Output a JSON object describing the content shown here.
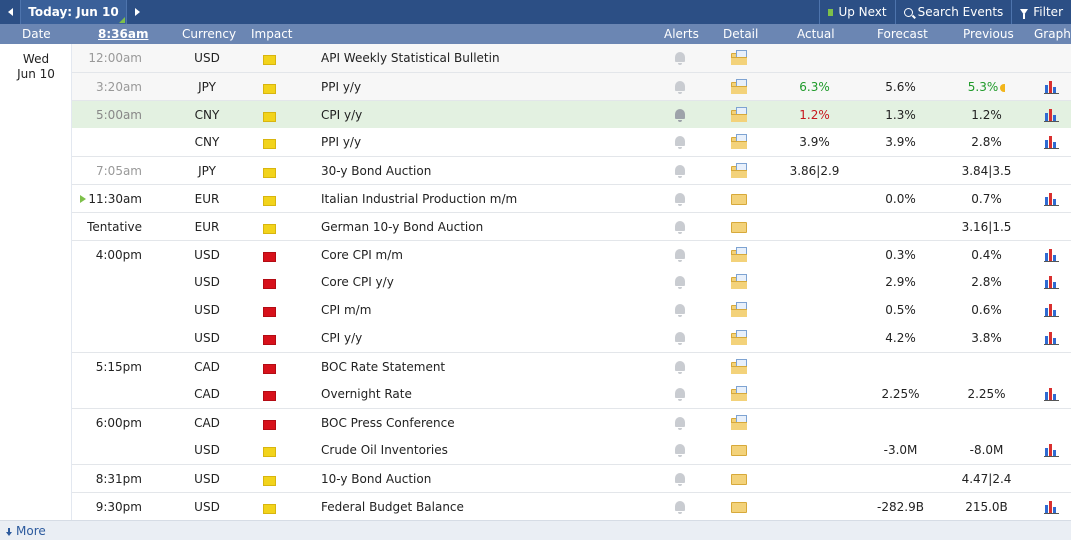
{
  "toolbar": {
    "today_label": "Today: Jun 10",
    "up_next_label": "Up Next",
    "search_label": "Search Events",
    "filter_label": "Filter"
  },
  "columns": {
    "date": "Date",
    "time": "8:36am",
    "currency": "Currency",
    "impact": "Impact",
    "alerts": "Alerts",
    "detail": "Detail",
    "actual": "Actual",
    "forecast": "Forecast",
    "previous": "Previous",
    "graph": "Graph"
  },
  "date": {
    "day": "Wed",
    "date": "Jun 10"
  },
  "events": [
    {
      "time": "12:00am",
      "currency": "USD",
      "impact": "low",
      "event": "API Weekly Statistical Bulletin",
      "detail": "doc",
      "actual": "",
      "forecast": "",
      "previous": "",
      "graph": false
    },
    {
      "time": "3:20am",
      "currency": "JPY",
      "impact": "low",
      "event": "PPI y/y",
      "detail": "doc",
      "actual": "6.3%",
      "forecast": "5.6%",
      "previous": "5.3%",
      "graph": true
    },
    {
      "time": "5:00am",
      "currency": "CNY",
      "impact": "low",
      "event": "CPI y/y",
      "detail": "doc",
      "actual": "1.2%",
      "forecast": "1.3%",
      "previous": "1.2%",
      "graph": true
    },
    {
      "time": "",
      "currency": "CNY",
      "impact": "low",
      "event": "PPI y/y",
      "detail": "doc",
      "actual": "3.9%",
      "forecast": "3.9%",
      "previous": "2.8%",
      "graph": true
    },
    {
      "time": "7:05am",
      "currency": "JPY",
      "impact": "low",
      "event": "30-y Bond Auction",
      "detail": "doc",
      "actual": "3.86|2.9",
      "forecast": "",
      "previous": "3.84|3.5",
      "graph": false
    },
    {
      "time": "11:30am",
      "currency": "EUR",
      "impact": "low",
      "event": "Italian Industrial Production m/m",
      "detail": "plain",
      "actual": "",
      "forecast": "0.0%",
      "previous": "0.7%",
      "graph": true
    },
    {
      "time": "Tentative",
      "currency": "EUR",
      "impact": "low",
      "event": "German 10-y Bond Auction",
      "detail": "plain",
      "actual": "",
      "forecast": "",
      "previous": "3.16|1.5",
      "graph": false
    },
    {
      "time": "4:00pm",
      "currency": "USD",
      "impact": "high",
      "event": "Core CPI m/m",
      "detail": "doc",
      "actual": "",
      "forecast": "0.3%",
      "previous": "0.4%",
      "graph": true
    },
    {
      "time": "",
      "currency": "USD",
      "impact": "high",
      "event": "Core CPI y/y",
      "detail": "doc",
      "actual": "",
      "forecast": "2.9%",
      "previous": "2.8%",
      "graph": true
    },
    {
      "time": "",
      "currency": "USD",
      "impact": "high",
      "event": "CPI m/m",
      "detail": "doc",
      "actual": "",
      "forecast": "0.5%",
      "previous": "0.6%",
      "graph": true
    },
    {
      "time": "",
      "currency": "USD",
      "impact": "high",
      "event": "CPI y/y",
      "detail": "doc",
      "actual": "",
      "forecast": "4.2%",
      "previous": "3.8%",
      "graph": true
    },
    {
      "time": "5:15pm",
      "currency": "CAD",
      "impact": "high",
      "event": "BOC Rate Statement",
      "detail": "doc",
      "actual": "",
      "forecast": "",
      "previous": "",
      "graph": false
    },
    {
      "time": "",
      "currency": "CAD",
      "impact": "high",
      "event": "Overnight Rate",
      "detail": "doc",
      "actual": "",
      "forecast": "2.25%",
      "previous": "2.25%",
      "graph": true
    },
    {
      "time": "6:00pm",
      "currency": "CAD",
      "impact": "high",
      "event": "BOC Press Conference",
      "detail": "doc",
      "actual": "",
      "forecast": "",
      "previous": "",
      "graph": false
    },
    {
      "time": "",
      "currency": "USD",
      "impact": "low",
      "event": "Crude Oil Inventories",
      "detail": "plain",
      "actual": "",
      "forecast": "-3.0M",
      "previous": "-8.0M",
      "graph": true
    },
    {
      "time": "8:31pm",
      "currency": "USD",
      "impact": "low",
      "event": "10-y Bond Auction",
      "detail": "plain",
      "actual": "",
      "forecast": "",
      "previous": "4.47|2.4",
      "graph": false
    },
    {
      "time": "9:30pm",
      "currency": "USD",
      "impact": "low",
      "event": "Federal Budget Balance",
      "detail": "plain",
      "actual": "",
      "forecast": "-282.9B",
      "previous": "215.0B",
      "graph": true
    }
  ],
  "footer": {
    "more_label": "More"
  }
}
